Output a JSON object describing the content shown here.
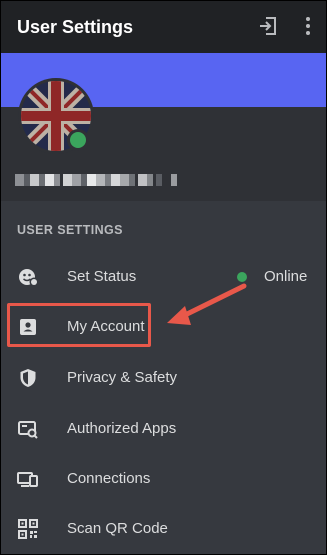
{
  "appbar": {
    "title": "User Settings",
    "logout_icon": "logout-icon",
    "more_icon": "more-vertical-icon"
  },
  "profile": {
    "avatar": "union-jack-flag-avatar",
    "status_color": "#3ba55d",
    "banner_color": "#5865f2",
    "username_obscured": true
  },
  "section": {
    "header": "USER SETTINGS"
  },
  "menu": {
    "items": [
      {
        "label": "Set Status",
        "icon": "status-face-icon",
        "status_text": "Online"
      },
      {
        "label": "My Account",
        "icon": "account-card-icon"
      },
      {
        "label": "Privacy & Safety",
        "icon": "shield-icon"
      },
      {
        "label": "Authorized Apps",
        "icon": "authorized-apps-icon"
      },
      {
        "label": "Connections",
        "icon": "devices-icon"
      },
      {
        "label": "Scan QR Code",
        "icon": "qr-code-icon"
      }
    ]
  },
  "annotation": {
    "highlight_color": "#e8584a",
    "highlighted_item": "My Account"
  }
}
